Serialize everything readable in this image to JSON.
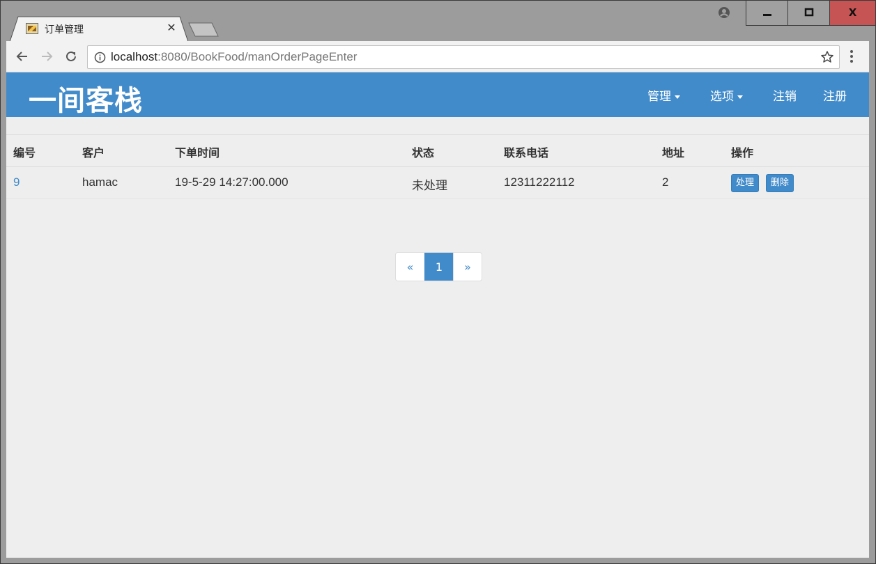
{
  "browser": {
    "tab_title": "订单管理",
    "url_host": "localhost",
    "url_rest": ":8080/BookFood/manOrderPageEnter"
  },
  "navbar": {
    "brand": "一间客栈",
    "items": [
      {
        "label": "管理",
        "dropdown": true
      },
      {
        "label": "选项",
        "dropdown": true
      },
      {
        "label": "注销",
        "dropdown": false
      },
      {
        "label": "注册",
        "dropdown": false
      }
    ]
  },
  "table": {
    "headers": [
      "编号",
      "客户",
      "下单时间",
      "状态",
      "联系电话",
      "地址",
      "操作"
    ],
    "rows": [
      {
        "id": "9",
        "customer": "hamac",
        "order_time": "19-5-29 14:27:00.000",
        "status": "未处理",
        "phone": "12311222112",
        "address": "2",
        "actions": [
          "处理",
          "删除"
        ]
      }
    ]
  },
  "pagination": {
    "prev": "«",
    "pages": [
      "1"
    ],
    "current": "1",
    "next": "»"
  },
  "colors": {
    "primary": "#428bca",
    "page_bg": "#eeeeee"
  }
}
